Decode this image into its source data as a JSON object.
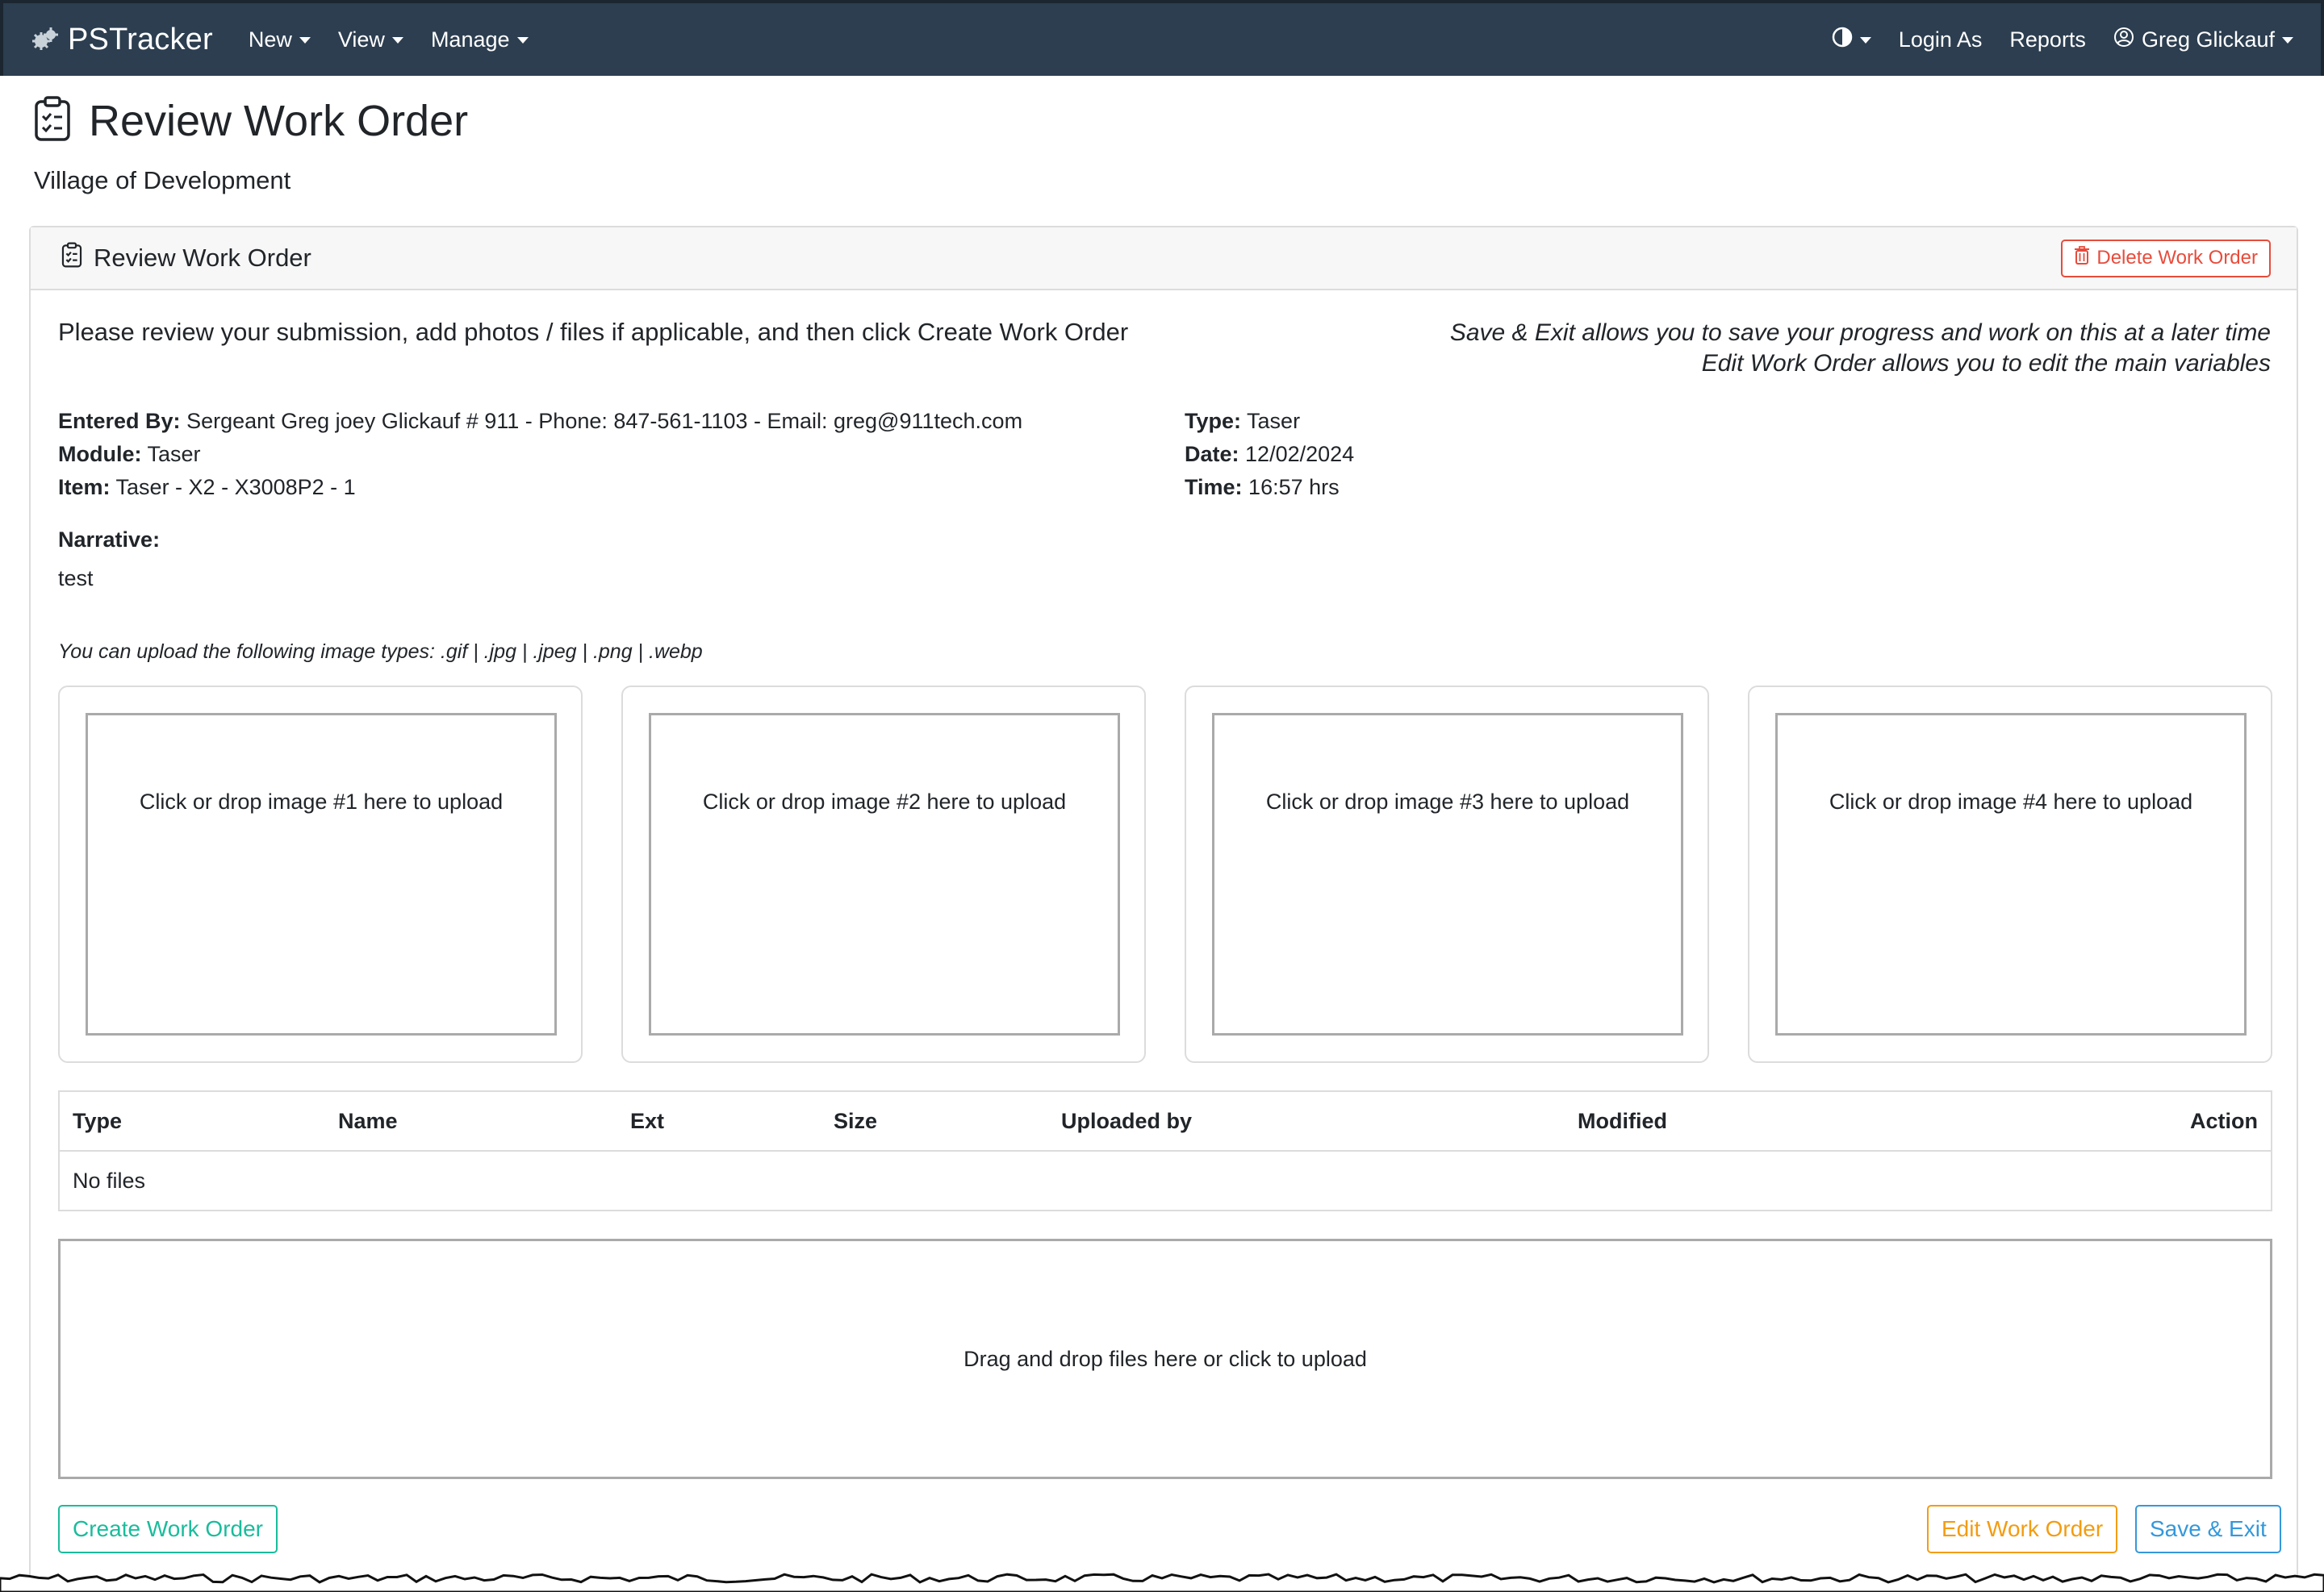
{
  "navbar": {
    "brand": "PSTracker",
    "menu": [
      {
        "label": "New"
      },
      {
        "label": "View"
      },
      {
        "label": "Manage"
      }
    ],
    "right": {
      "login_as": "Login As",
      "reports": "Reports",
      "user": "Greg Glickauf"
    }
  },
  "page": {
    "title": "Review Work Order",
    "subtitle": "Village of Development"
  },
  "card": {
    "title": "Review Work Order",
    "delete_label": "Delete Work Order",
    "intro": "Please review your submission, add photos / files if applicable, and then click Create Work Order",
    "hint_line1": "Save & Exit allows you to save your progress and work on this at a later time",
    "hint_line2": "Edit Work Order allows you to edit the main variables"
  },
  "details": {
    "entered_by_label": "Entered By:",
    "entered_by": "Sergeant Greg joey Glickauf # 911 - Phone: 847-561-1103 - Email: greg@911tech.com",
    "module_label": "Module:",
    "module": "Taser",
    "item_label": "Item:",
    "item": "Taser - X2 - X3008P2 - 1",
    "type_label": "Type:",
    "type": "Taser",
    "date_label": "Date:",
    "date": "12/02/2024",
    "time_label": "Time:",
    "time": "16:57 hrs"
  },
  "narrative": {
    "label": "Narrative:",
    "text": "test"
  },
  "upload": {
    "note": "You can upload the following image types:  .gif | .jpg | .jpeg | .png | .webp",
    "slots": [
      "Click or drop image #1 here to upload",
      "Click or drop image #2 here to upload",
      "Click or drop image #3 here to upload",
      "Click or drop image #4 here to upload"
    ]
  },
  "files": {
    "columns": {
      "type": "Type",
      "name": "Name",
      "ext": "Ext",
      "size": "Size",
      "uploaded_by": "Uploaded by",
      "modified": "Modified",
      "action": "Action"
    },
    "empty": "No files",
    "drop_text": "Drag and drop files here or click to upload"
  },
  "actions": {
    "create": "Create Work Order",
    "edit": "Edit Work Order",
    "save": "Save & Exit"
  },
  "colors": {
    "navbar": "#2c3e50",
    "danger": "#e74c3c",
    "success": "#1abc9c",
    "warning": "#f39c12",
    "info": "#3498db"
  },
  "icons": {
    "brand": "gear-cluster-icon",
    "theme": "contrast-icon",
    "user": "user-circle-icon",
    "page": "clipboard-check-icon",
    "delete": "trash-icon"
  }
}
